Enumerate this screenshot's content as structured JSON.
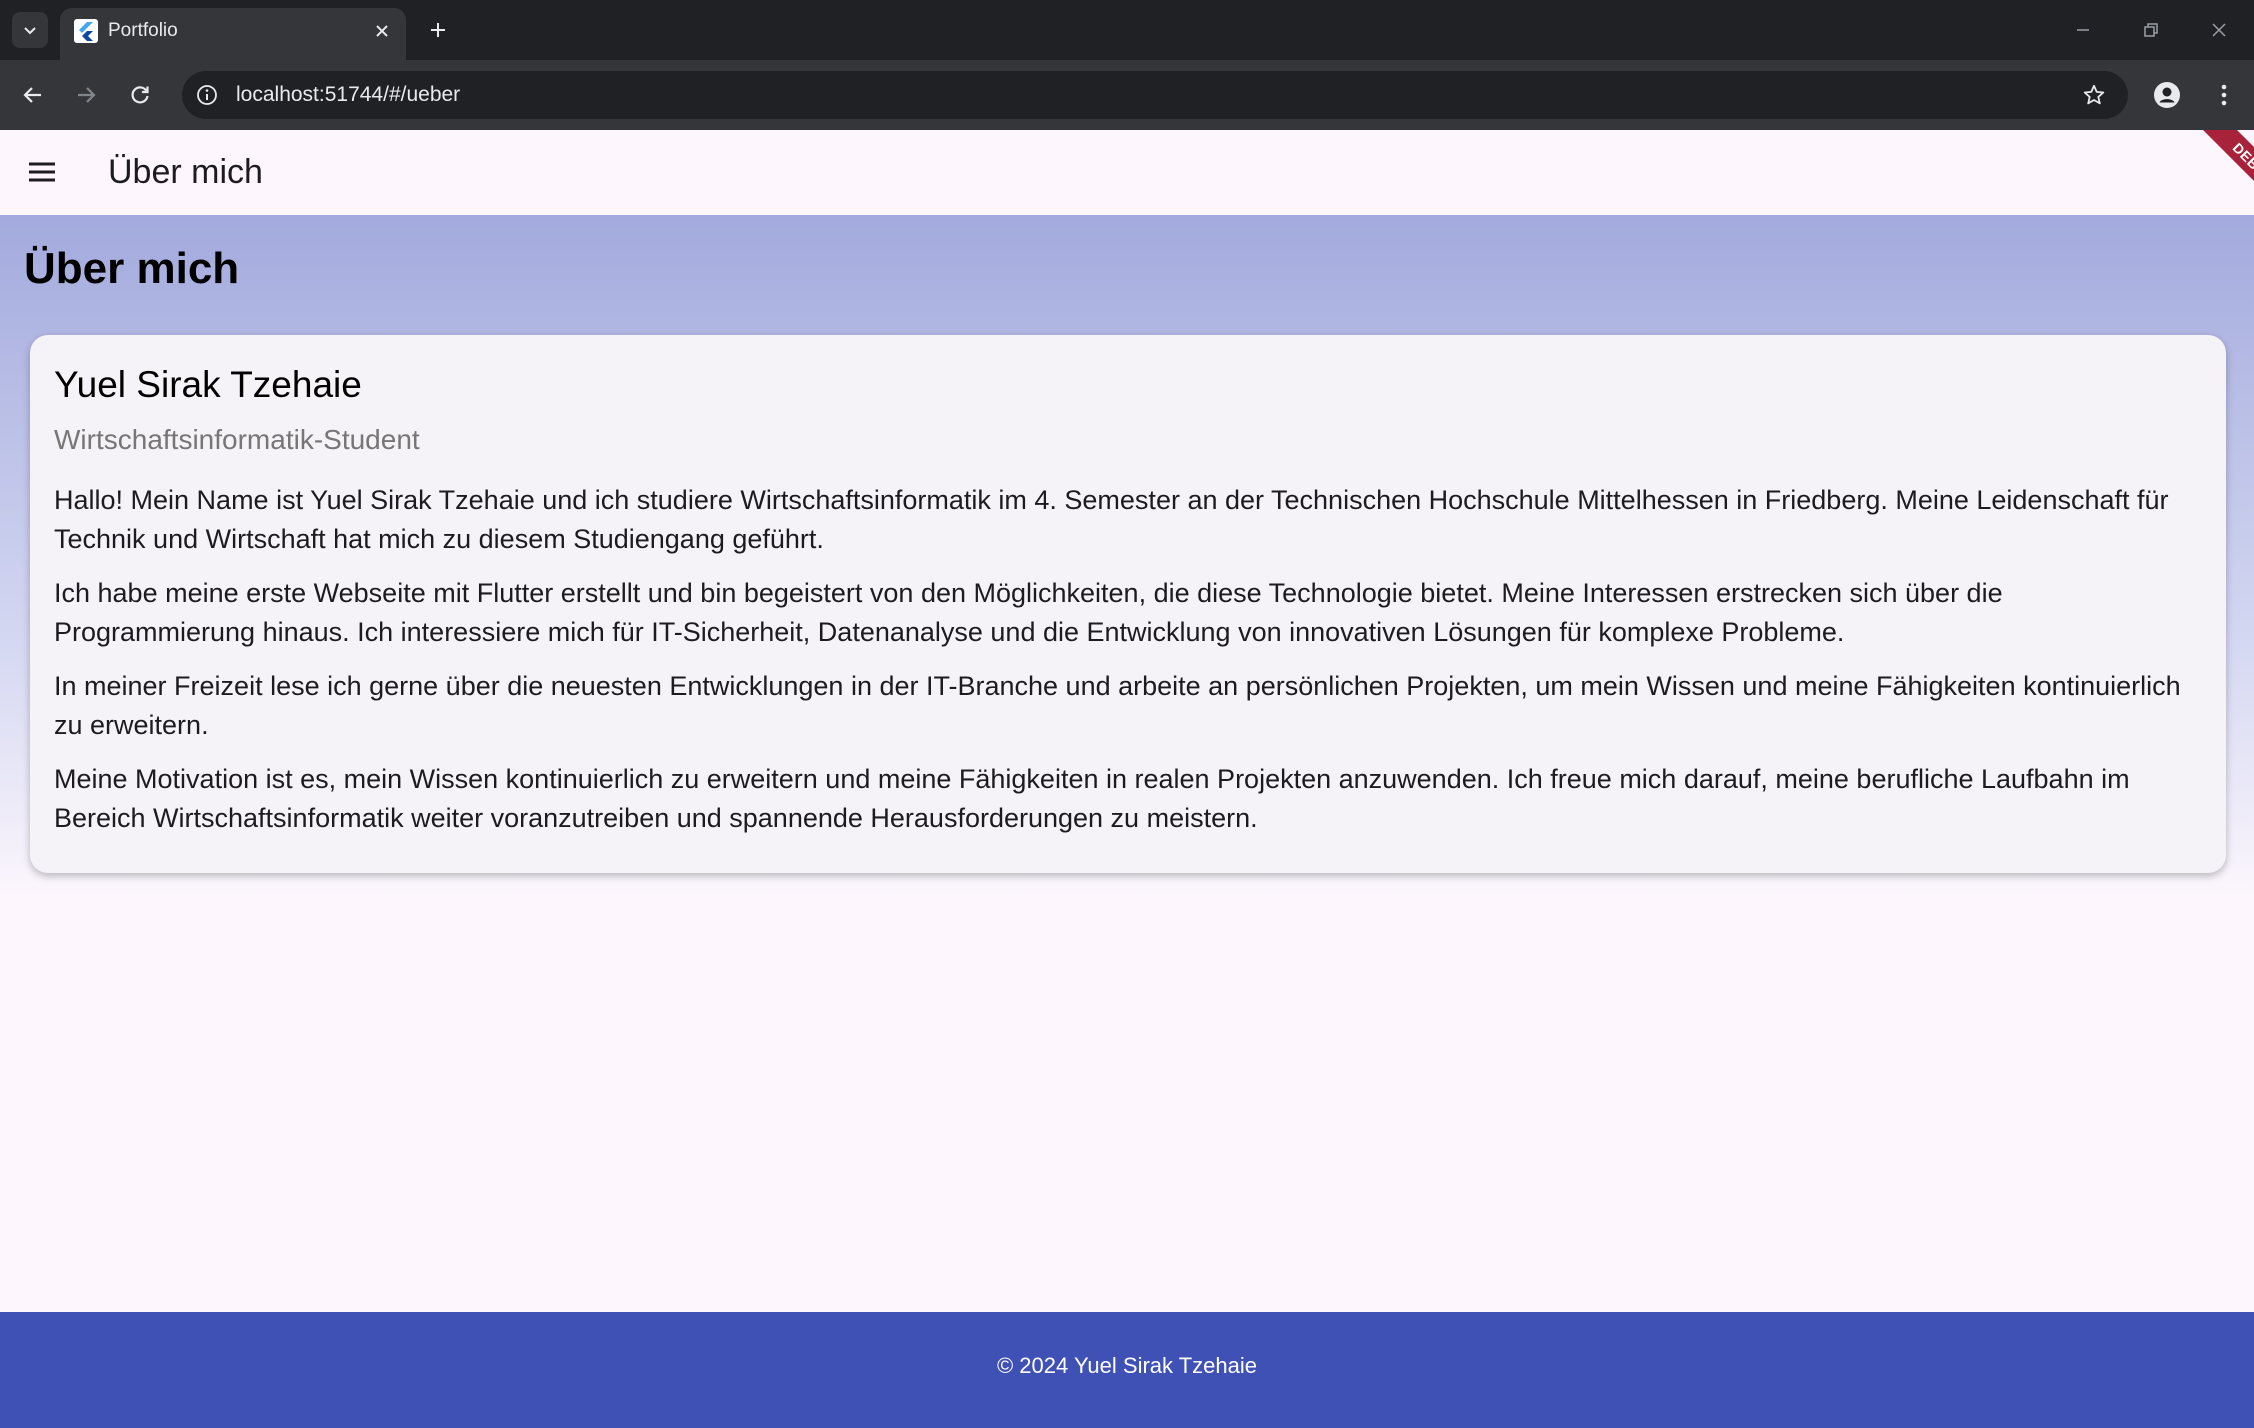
{
  "browser": {
    "tab_title": "Portfolio",
    "url": "localhost:51744/#/ueber"
  },
  "app": {
    "appbar_title": "Über mich",
    "debug_label": "DEBUG",
    "page_heading": "Über mich"
  },
  "card": {
    "name": "Yuel Sirak Tzehaie",
    "subtitle": "Wirtschaftsinformatik-Student",
    "paragraphs": [
      "Hallo! Mein Name ist Yuel Sirak Tzehaie und ich studiere Wirtschaftsinformatik im 4. Semester an der Technischen Hochschule Mittelhessen in Friedberg. Meine Leidenschaft für Technik und Wirtschaft hat mich zu diesem Studiengang geführt.",
      "Ich habe meine erste Webseite mit Flutter erstellt und bin begeistert von den Möglichkeiten, die diese Technologie bietet. Meine Interessen erstrecken sich über die Programmierung hinaus. Ich interessiere mich für IT-Sicherheit, Datenanalyse und die Entwicklung von innovativen Lösungen für komplexe Probleme.",
      "In meiner Freizeit lese ich gerne über die neuesten Entwicklungen in der IT-Branche und arbeite an persönlichen Projekten, um mein Wissen und meine Fähigkeiten kontinuierlich zu erweitern.",
      "Meine Motivation ist es, mein Wissen kontinuierlich zu erweitern und meine Fähigkeiten in realen Projekten anzuwenden. Ich freue mich darauf, meine berufliche Laufbahn im Bereich Wirtschaftsinformatik weiter voranzutreiben und spannende Herausforderungen zu meistern."
    ]
  },
  "footer": {
    "text": "© 2024 Yuel Sirak Tzehaie"
  },
  "colors": {
    "appbar_bg": "#fdf7fd",
    "gradient_top": "#a3aadd",
    "footer_bg": "#3f51b5",
    "debug_ribbon": "#a8223a"
  },
  "icons": {
    "tab_list": "chevron-down-icon",
    "favicon": "flutter-icon",
    "tab_close": "close-icon",
    "new_tab": "plus-icon",
    "back": "arrow-left-icon",
    "forward": "arrow-right-icon",
    "reload": "reload-icon",
    "site_info": "info-icon",
    "bookmark": "star-icon",
    "profile": "person-icon",
    "browser_menu": "more-vert-icon",
    "drawer": "menu-icon"
  }
}
